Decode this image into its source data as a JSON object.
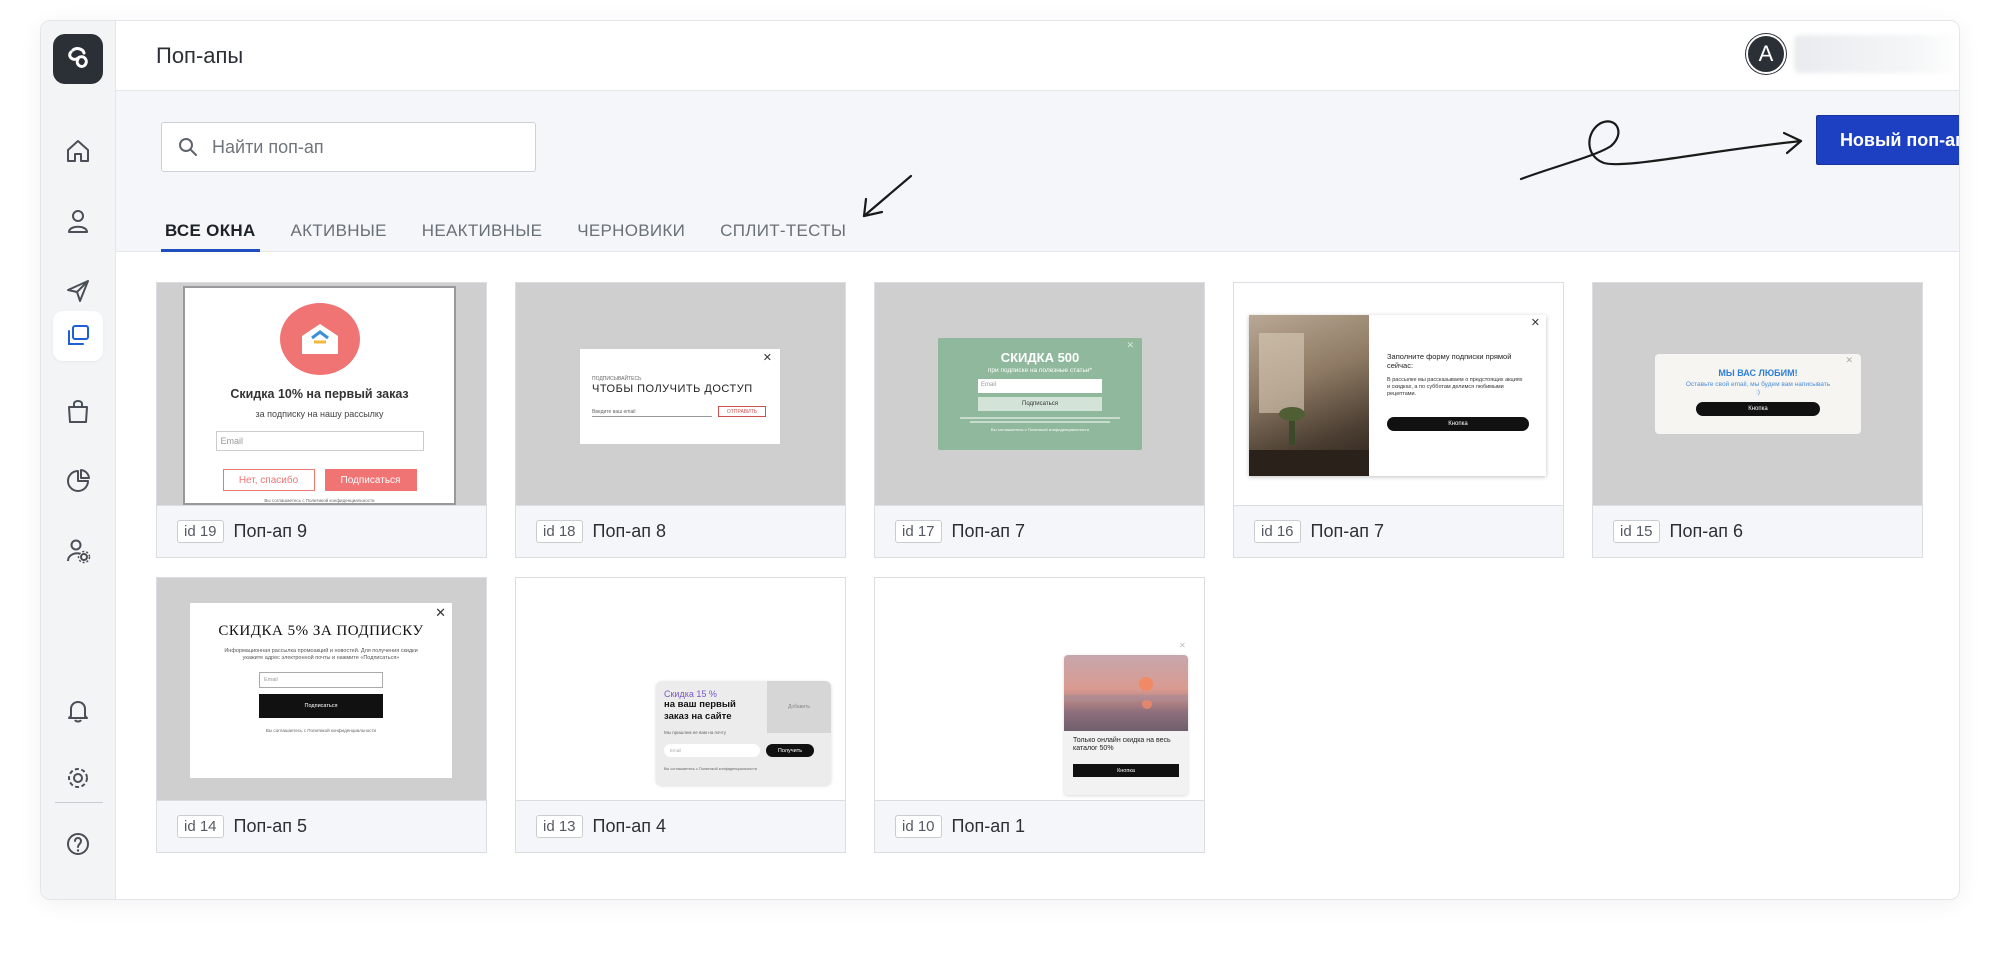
{
  "header": {
    "title": "Поп-апы",
    "avatar_letter": "A"
  },
  "search": {
    "placeholder": "Найти поп-ап"
  },
  "tabs": [
    {
      "label": "ВСЕ ОКНА",
      "active": true
    },
    {
      "label": "АКТИВНЫЕ",
      "active": false
    },
    {
      "label": "НЕАКТИВНЫЕ",
      "active": false
    },
    {
      "label": "ЧЕРНОВИКИ",
      "active": false
    },
    {
      "label": "СПЛИТ-ТЕСТЫ",
      "active": false
    }
  ],
  "new_button": "Новый поп-ап",
  "sidebar": {
    "items": [
      {
        "icon": "home-icon"
      },
      {
        "icon": "user-icon"
      },
      {
        "icon": "send-icon"
      },
      {
        "icon": "popups-icon",
        "active": true
      },
      {
        "icon": "shopping-bag-icon"
      },
      {
        "icon": "pie-chart-icon"
      },
      {
        "icon": "user-settings-icon"
      },
      {
        "icon": "bell-icon"
      },
      {
        "icon": "gear-icon"
      },
      {
        "icon": "help-icon"
      }
    ]
  },
  "cards": [
    {
      "id": "id 19",
      "name": "Поп-ап 9",
      "preview": {
        "title": "Скидка 10% на первый заказ",
        "subtitle": "за подписку на нашу рассылку",
        "email_placeholder": "Email",
        "decline": "Нет, спасибо",
        "subscribe": "Подписаться",
        "consent": "Вы соглашаетесь с Политикой конфиденциальности"
      }
    },
    {
      "id": "id 18",
      "name": "Поп-ап 8",
      "preview": {
        "kicker": "ПОДПИСЫВАЙТЕСЬ",
        "title": "ЧТОБЫ ПОЛУЧИТЬ ДОСТУП",
        "field_label": "Введите ваш email",
        "button": "ОТПРАВИТЬ"
      }
    },
    {
      "id": "id 17",
      "name": "Поп-ап 7",
      "preview": {
        "title": "СКИДКА 500",
        "subtitle": "при подписке на полезные статьи*",
        "email_placeholder": "Email",
        "button": "Подписаться",
        "consent": "Вы соглашаетесь с Политикой конфиденциальности"
      }
    },
    {
      "id": "id 16",
      "name": "Поп-ап 7",
      "preview": {
        "title": "Заполните форму подписки прямой сейчас:",
        "text": "В рассылке мы рассказываем о предстоящих акциях и скидках, а по субботам делимся любимыми рецептами.",
        "button": "Кнопка"
      }
    },
    {
      "id": "id 15",
      "name": "Поп-ап 6",
      "preview": {
        "title": "МЫ ВАС ЛЮБИМ!",
        "text": "Оставьте свой email, мы будем вам написывать :)",
        "button": "Кнопка"
      }
    },
    {
      "id": "id 14",
      "name": "Поп-ап 5",
      "preview": {
        "title": "СКИДКА 5% ЗА ПОДПИСКУ",
        "text": "Информационная рассылка промоакций и новостей. Для получения скидки укажите адрес электронной почты и нажмите «Подписаться»",
        "email_placeholder": "Email",
        "button": "Подписаться",
        "consent": "Вы соглашаетесь с Политикой конфиденциальности"
      }
    },
    {
      "id": "id 13",
      "name": "Поп-ап 4",
      "preview": {
        "accent": "Скидка 15 %",
        "title": "на ваш первый заказ на сайте",
        "text": "Мы пришлем ее вам на почту",
        "email_placeholder": "Email",
        "button": "Получить",
        "image_label": "Добавить",
        "consent": "Вы соглашаетесь с Политикой конфиденциальности"
      }
    },
    {
      "id": "id 10",
      "name": "Поп-ап 1",
      "preview": {
        "title": "Только онлайн скидка на весь каталог 50%",
        "button": "Кнопка"
      }
    }
  ],
  "colors": {
    "accent": "#1d3fc1",
    "sidebar": "#f3f4f6",
    "green_popup": "#8fb89c",
    "coral": "#f06a6a"
  }
}
